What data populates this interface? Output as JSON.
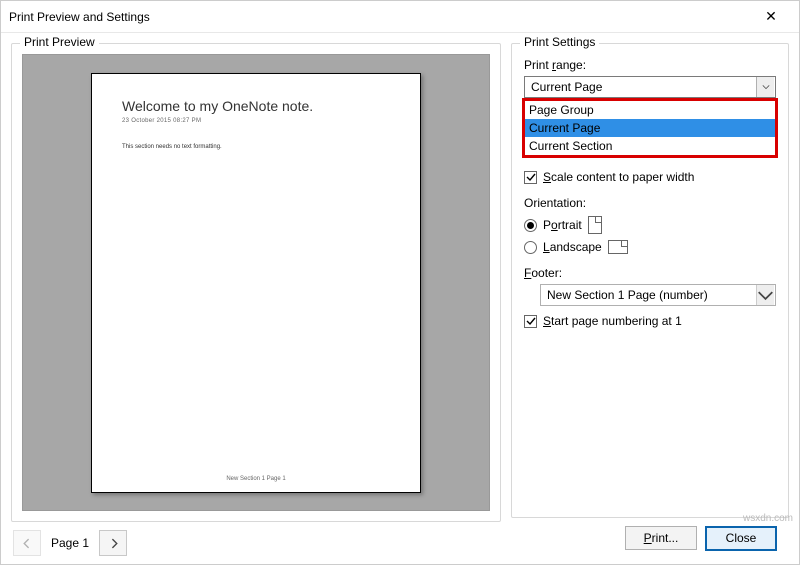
{
  "window": {
    "title": "Print Preview and Settings"
  },
  "preview": {
    "legend": "Print Preview",
    "page_title": "Welcome to my OneNote note.",
    "page_meta": "23 October 2015      08:27 PM",
    "page_body": "This section needs no text formatting.",
    "page_footer": "New Section 1 Page 1",
    "pager_label": "Page 1"
  },
  "settings": {
    "legend": "Print Settings",
    "print_range_label": "Print range:",
    "print_range_value": "Current Page",
    "print_range_options": [
      "Page Group",
      "Current Page",
      "Current Section"
    ],
    "print_range_selected_index": 1,
    "scale_label": "Scale content to paper width",
    "scale_checked": true,
    "orientation_label": "Orientation:",
    "orientation_portrait": "Portrait",
    "orientation_landscape": "Landscape",
    "orientation_value": "Portrait",
    "footer_label": "Footer:",
    "footer_value": "New Section 1 Page (number)",
    "start_numbering_label": "Start page numbering at 1",
    "start_numbering_checked": true
  },
  "buttons": {
    "print": "Print...",
    "close": "Close"
  },
  "watermark": "wsxdn.com",
  "underline": {
    "p": "P",
    "r": "r",
    "s": "S",
    "o_p": "P",
    "l": "L",
    "f": "F",
    "st": "S",
    "pr": "P"
  }
}
